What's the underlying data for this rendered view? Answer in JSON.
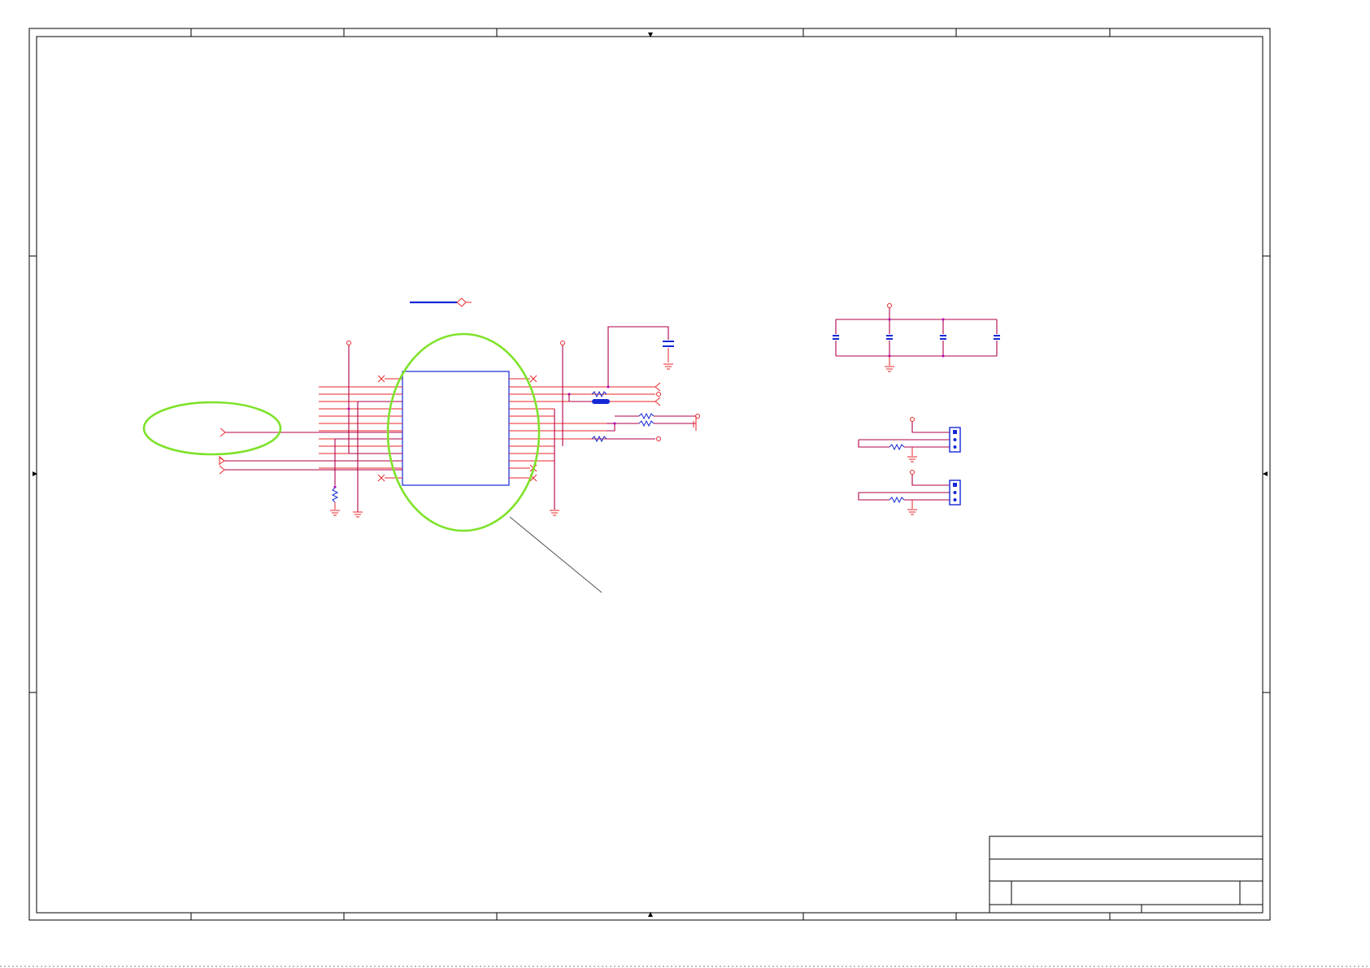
{
  "schematic": {
    "title_block": {
      "title": "",
      "document_number": "",
      "revision": "",
      "sheet": ""
    },
    "colors": {
      "wire": "#b0004a",
      "pin": "#e8262a",
      "component": "#1428d6",
      "highlight": "#7ee22a",
      "frame": "#000000"
    },
    "zones": {
      "columns": [
        "",
        "",
        "",
        "",
        "",
        "",
        "",
        ""
      ],
      "rows": [
        "",
        "",
        "",
        ""
      ]
    }
  }
}
